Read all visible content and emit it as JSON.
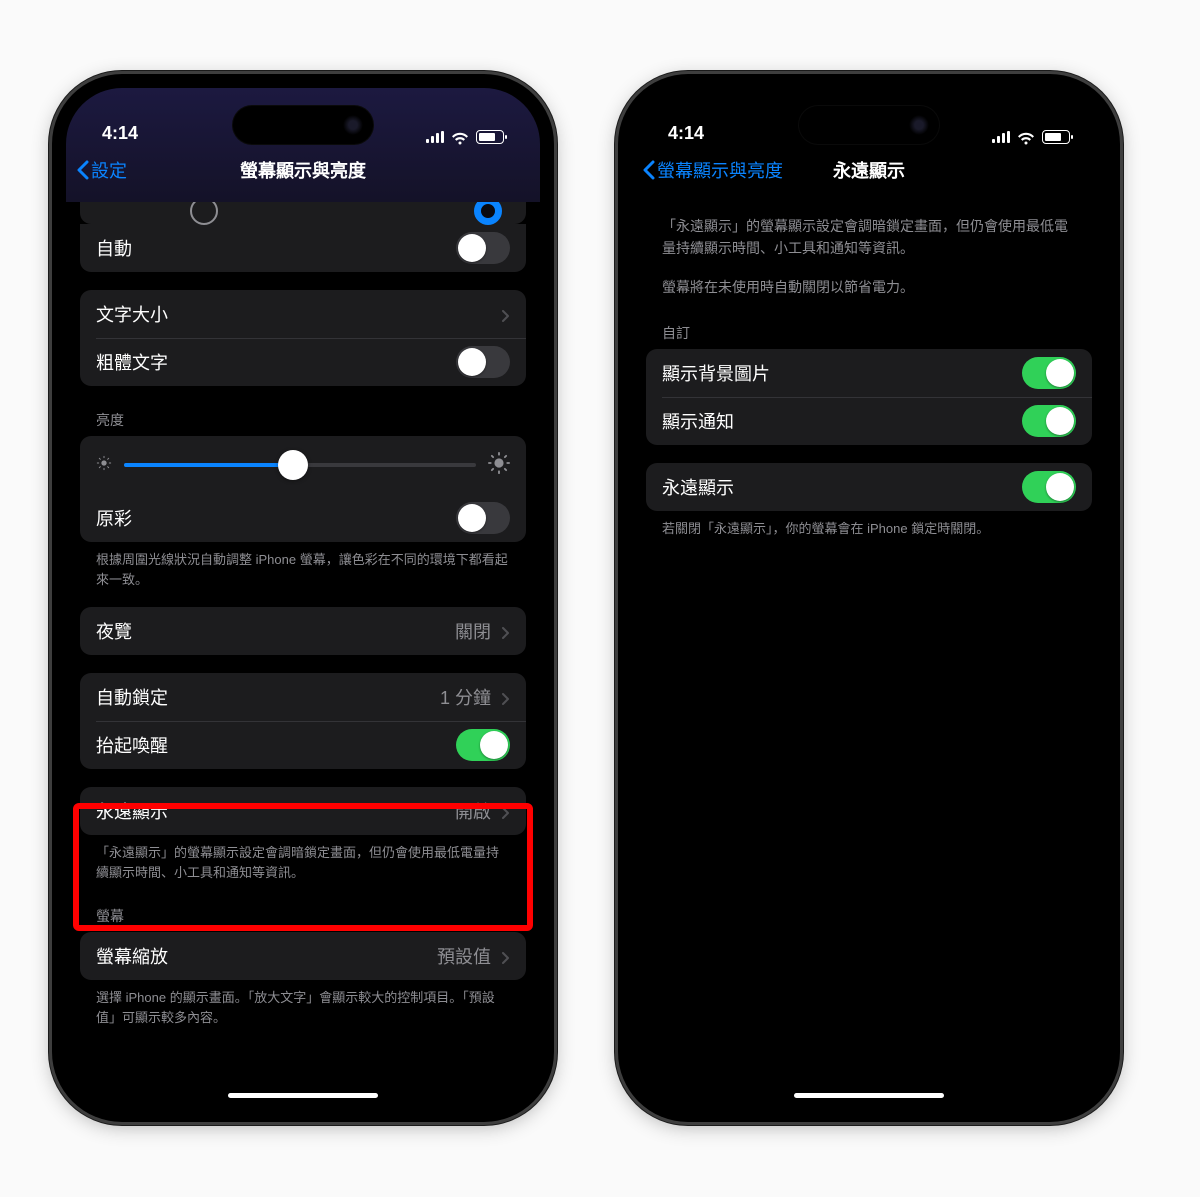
{
  "status": {
    "time": "4:14"
  },
  "left": {
    "back": "設定",
    "title": "螢幕顯示與亮度",
    "auto": "自動",
    "textSize": "文字大小",
    "boldText": "粗體文字",
    "brightnessHeader": "亮度",
    "trueTone": "原彩",
    "trueToneFooter": "根據周圍光線狀況自動調整 iPhone 螢幕，讓色彩在不同的環境下都看起來一致。",
    "nightShift": "夜覽",
    "nightShiftValue": "關閉",
    "autoLock": "自動鎖定",
    "autoLockValue": "1 分鐘",
    "raiseToWake": "抬起喚醒",
    "alwaysOn": "永遠顯示",
    "alwaysOnValue": "開啟",
    "alwaysOnFooter": "「永遠顯示」的螢幕顯示設定會調暗鎖定畫面，但仍會使用最低電量持續顯示時間、小工具和通知等資訊。",
    "screenHeader": "螢幕",
    "displayZoom": "螢幕縮放",
    "displayZoomValue": "預設值",
    "displayZoomFooter": "選擇 iPhone 的顯示畫面。「放大文字」會顯示較大的控制項目。「預設值」可顯示較多內容。",
    "brightness": 48
  },
  "right": {
    "back": "螢幕顯示與亮度",
    "title": "永遠顯示",
    "desc1": "「永遠顯示」的螢幕顯示設定會調暗鎖定畫面，但仍會使用最低電量持續顯示時間、小工具和通知等資訊。",
    "desc2": "螢幕將在未使用時自動關閉以節省電力。",
    "customHeader": "自訂",
    "showWallpaper": "顯示背景圖片",
    "showNotifications": "顯示通知",
    "alwaysOn": "永遠顯示",
    "alwaysOnFooter": "若關閉「永遠顯示」，你的螢幕會在 iPhone 鎖定時關閉。"
  }
}
